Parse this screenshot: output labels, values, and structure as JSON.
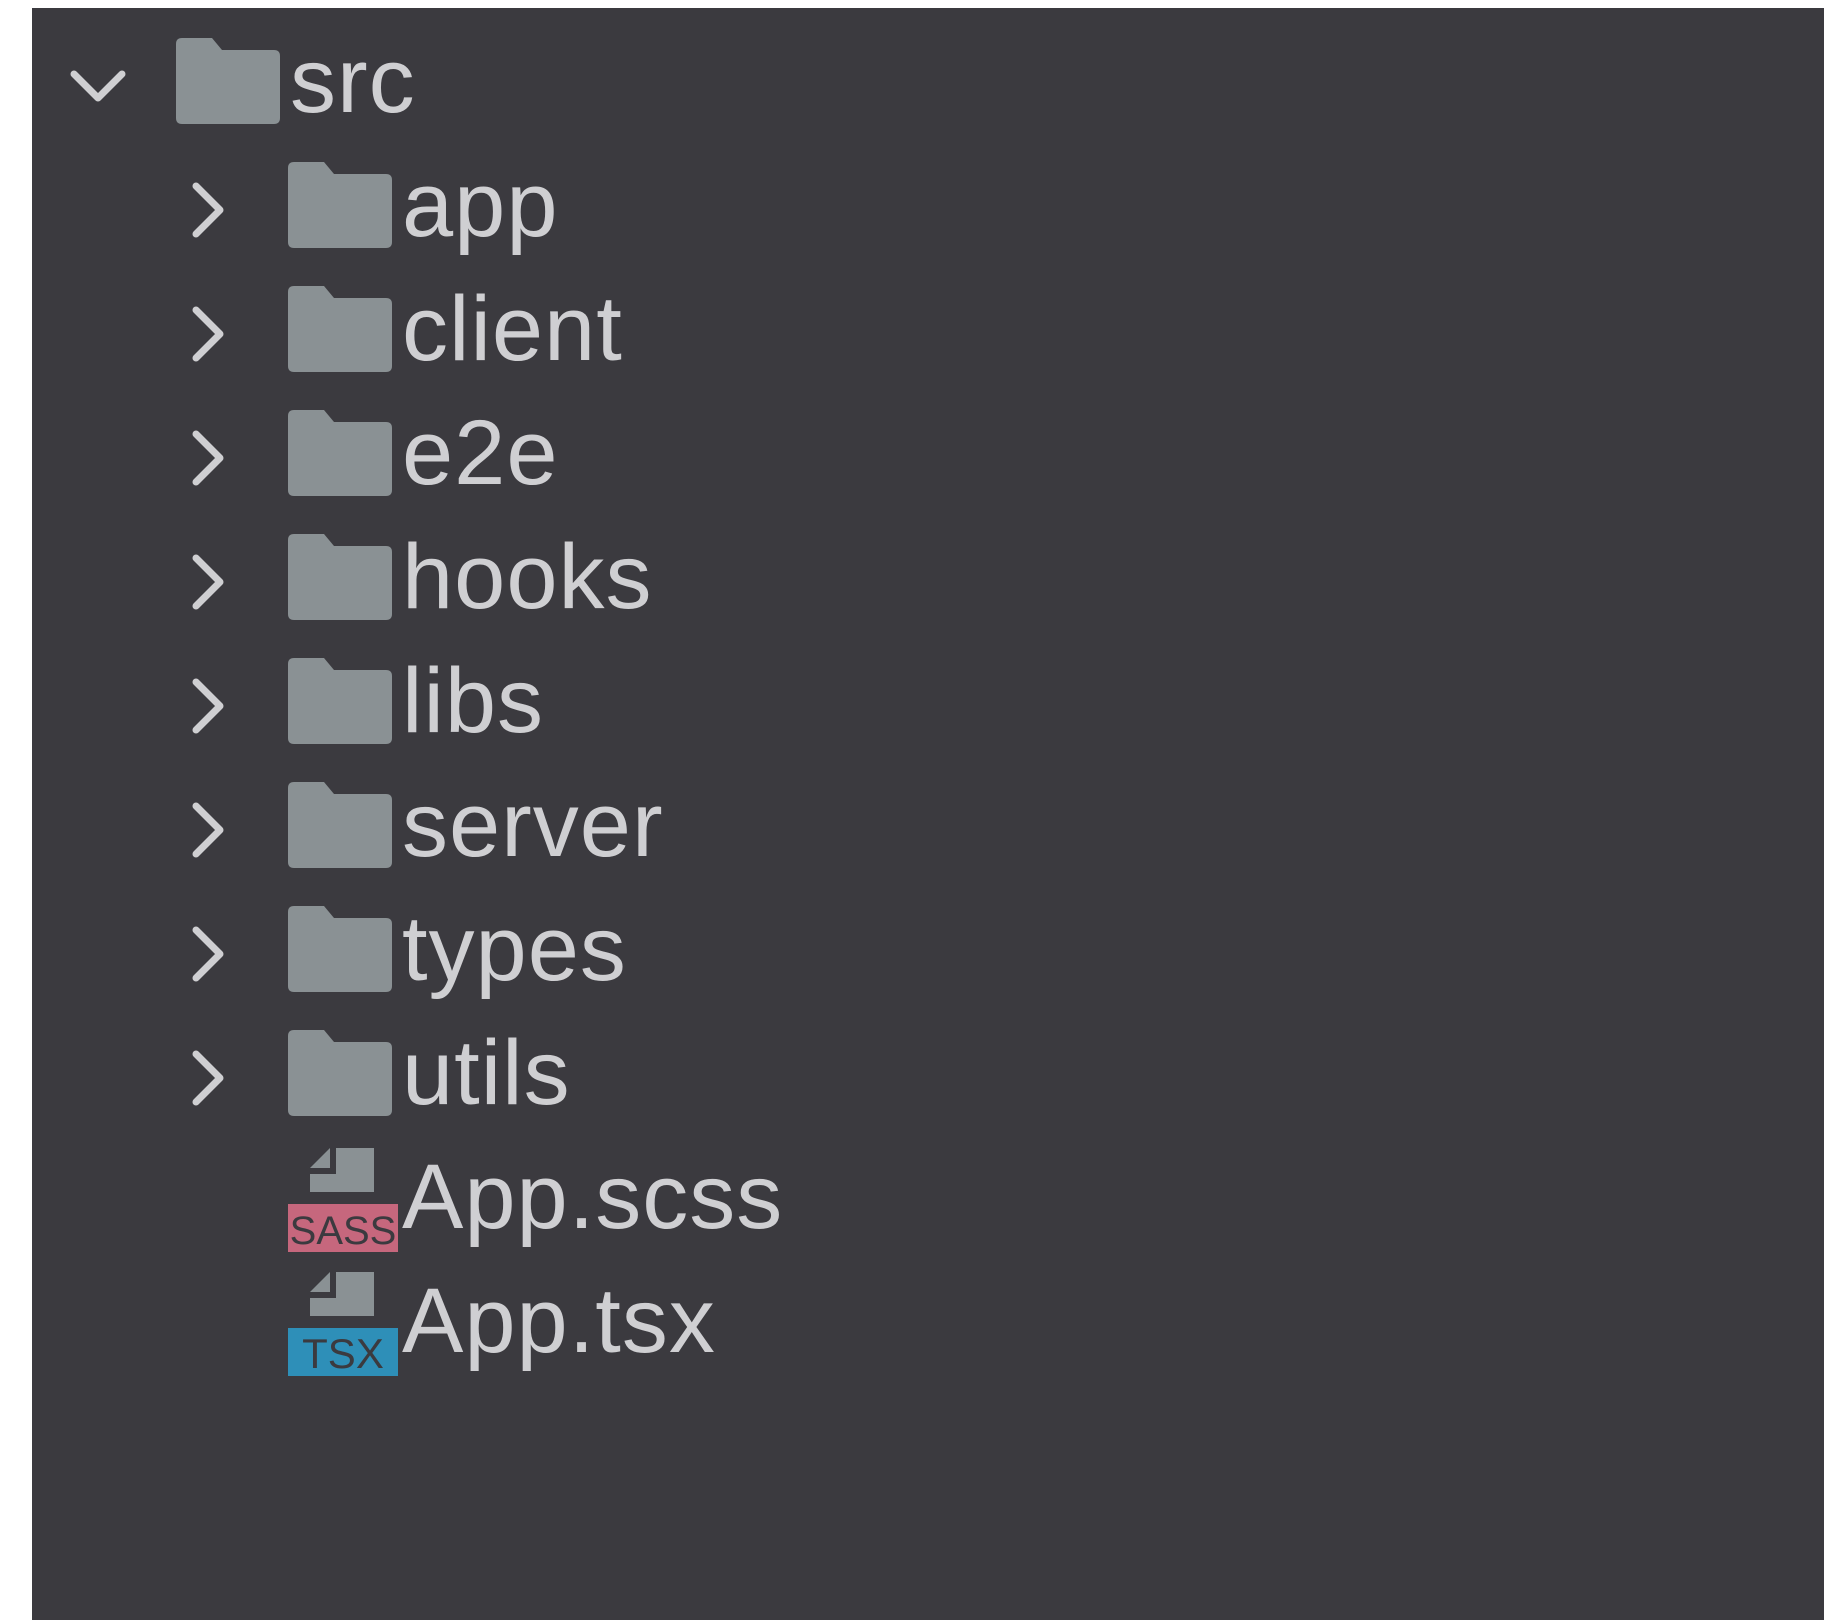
{
  "colors": {
    "panel_background": "#3b3a3f",
    "text": "#cfcfd2",
    "icon_gray": "#8a9194",
    "sass_badge": "#c6677d",
    "tsx_badge": "#2e8fb8"
  },
  "tree": {
    "root": {
      "label": "src",
      "expanded": true,
      "icon": "folder-icon"
    },
    "folders": [
      {
        "label": "app",
        "expanded": false,
        "icon": "folder-icon"
      },
      {
        "label": "client",
        "expanded": false,
        "icon": "folder-icon"
      },
      {
        "label": "e2e",
        "expanded": false,
        "icon": "folder-icon"
      },
      {
        "label": "hooks",
        "expanded": false,
        "icon": "folder-icon"
      },
      {
        "label": "libs",
        "expanded": false,
        "icon": "folder-icon"
      },
      {
        "label": "server",
        "expanded": false,
        "icon": "folder-icon"
      },
      {
        "label": "types",
        "expanded": false,
        "icon": "folder-icon"
      },
      {
        "label": "utils",
        "expanded": false,
        "icon": "folder-icon"
      }
    ],
    "files": [
      {
        "label": "App.scss",
        "icon": "sass-file-icon",
        "badge": "SASS"
      },
      {
        "label": "App.tsx",
        "icon": "tsx-file-icon",
        "badge": "TSX"
      }
    ]
  }
}
